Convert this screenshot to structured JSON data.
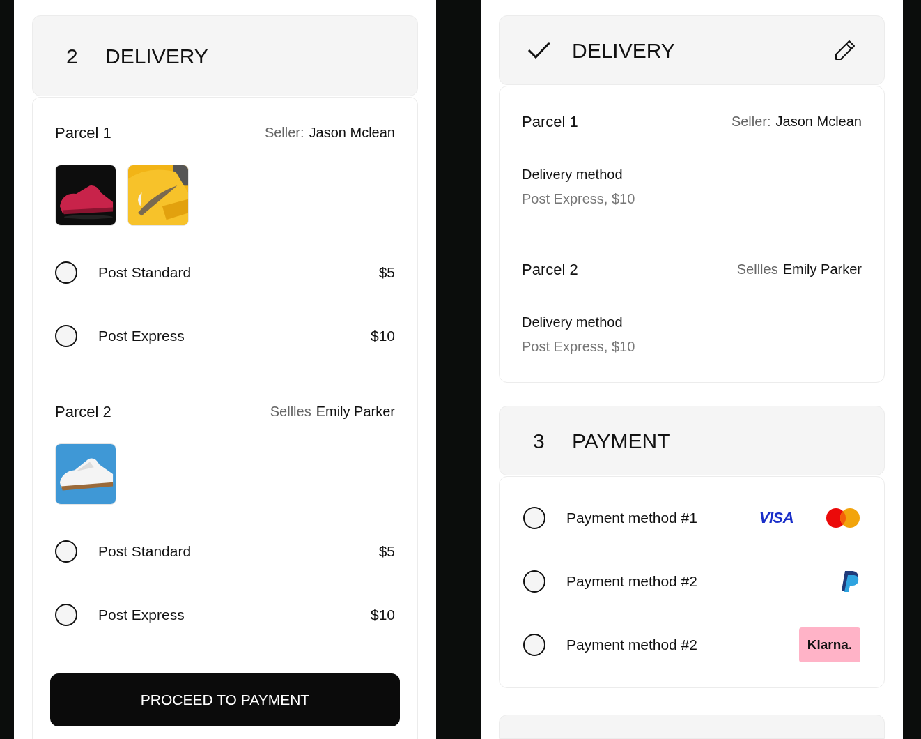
{
  "delivery_form": {
    "header": {
      "completed": false,
      "step": "2",
      "title": "DELIVERY"
    },
    "parcels": [
      {
        "title": "Parcel 1",
        "seller_label": "Seller:",
        "seller_name": "Jason Mclean",
        "photos": [
          {
            "kind": "picture"
          },
          {
            "kind": "picture"
          }
        ],
        "options": [
          {
            "label": "Post Standard",
            "price": "$5",
            "selected": false
          },
          {
            "label": "Post Express",
            "price": "$10",
            "selected": false
          }
        ]
      },
      {
        "title": "Parcel 2",
        "seller_label": "Sellles",
        "seller_name": "Emily Parker",
        "photos": [
          {
            "kind": "picture"
          }
        ],
        "options": [
          {
            "label": "Post Standard",
            "price": "$5",
            "selected": false
          },
          {
            "label": "Post Express",
            "price": "$10",
            "selected": false
          }
        ]
      }
    ],
    "proceed_button": "PROCEED TO PAYMENT"
  },
  "summary": {
    "delivery_header": {
      "completed": true,
      "title": "DELIVERY"
    },
    "parcels": [
      {
        "title": "Parcel 1",
        "seller_label": "Seller:",
        "seller_name": "Jason Mclean",
        "method_label": "Delivery method",
        "method_value": "Post Express, $10"
      },
      {
        "title": "Parcel 2",
        "seller_label": "Sellles",
        "seller_name": "Emily Parker",
        "method_label": "Delivery method",
        "method_value": "Post Express, $10"
      }
    ],
    "payment_header": {
      "completed": false,
      "step": "3",
      "title": "PAYMENT"
    },
    "payment_methods": [
      {
        "label": "Payment method #1",
        "selected": false,
        "logos": [
          {
            "kind": "wordmark",
            "text": "VISA"
          },
          {
            "kind": "mastercard"
          }
        ]
      },
      {
        "label": "Payment method #2",
        "selected": false,
        "logos": [
          {
            "kind": "paypal"
          }
        ]
      },
      {
        "label": "Payment method #2",
        "selected": false,
        "logos": [
          {
            "kind": "badge",
            "text": "Klarna."
          }
        ]
      }
    ]
  }
}
